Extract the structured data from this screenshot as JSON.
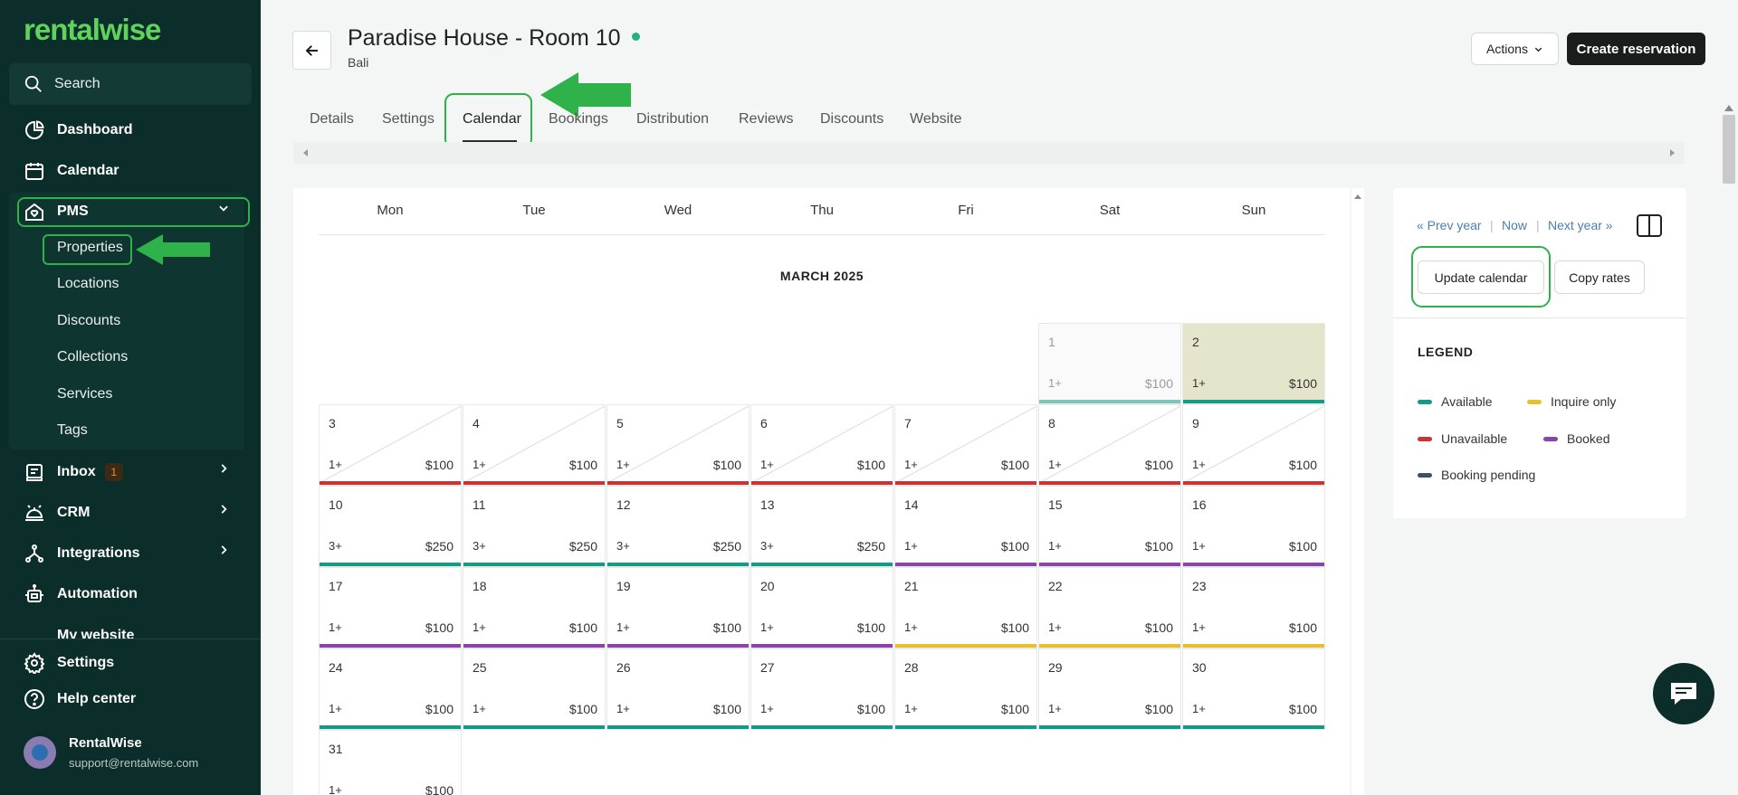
{
  "app": {
    "logo": "rentalwise"
  },
  "sidebar": {
    "search_label": "Search",
    "nav": {
      "dashboard": "Dashboard",
      "calendar": "Calendar",
      "pms": "PMS",
      "inbox": "Inbox",
      "inbox_badge": "1",
      "crm": "CRM",
      "integrations": "Integrations",
      "automation": "Automation",
      "my_website": "My website",
      "settings": "Settings",
      "help": "Help center"
    },
    "pms_items": [
      "Properties",
      "Locations",
      "Discounts",
      "Collections",
      "Services",
      "Tags"
    ],
    "user": {
      "name": "RentalWise",
      "email": "support@rentalwise.com"
    }
  },
  "header": {
    "title": "Paradise House - Room 10",
    "subtitle": "Bali",
    "actions_label": "Actions",
    "create_label": "Create reservation"
  },
  "tabs": [
    "Details",
    "Settings",
    "Calendar",
    "Bookings",
    "Distribution",
    "Reviews",
    "Discounts",
    "Website"
  ],
  "calendar": {
    "weekdays": [
      "Mon",
      "Tue",
      "Wed",
      "Thu",
      "Fri",
      "Sat",
      "Sun"
    ],
    "month": "MARCH 2025",
    "days": [
      {
        "d": "1",
        "min": "1+",
        "price": "$100",
        "status": "available",
        "past": true
      },
      {
        "d": "2",
        "min": "1+",
        "price": "$100",
        "status": "available",
        "today": true
      },
      {
        "d": "3",
        "min": "1+",
        "price": "$100",
        "status": "unavailable",
        "diag": true
      },
      {
        "d": "4",
        "min": "1+",
        "price": "$100",
        "status": "unavailable",
        "diag": true
      },
      {
        "d": "5",
        "min": "1+",
        "price": "$100",
        "status": "unavailable",
        "diag": true
      },
      {
        "d": "6",
        "min": "1+",
        "price": "$100",
        "status": "unavailable",
        "diag": true
      },
      {
        "d": "7",
        "min": "1+",
        "price": "$100",
        "status": "unavailable",
        "diag": true
      },
      {
        "d": "8",
        "min": "1+",
        "price": "$100",
        "status": "unavailable",
        "diag": true
      },
      {
        "d": "9",
        "min": "1+",
        "price": "$100",
        "status": "unavailable",
        "diag": true
      },
      {
        "d": "10",
        "min": "3+",
        "price": "$250",
        "status": "available"
      },
      {
        "d": "11",
        "min": "3+",
        "price": "$250",
        "status": "available"
      },
      {
        "d": "12",
        "min": "3+",
        "price": "$250",
        "status": "available"
      },
      {
        "d": "13",
        "min": "3+",
        "price": "$250",
        "status": "available"
      },
      {
        "d": "14",
        "min": "1+",
        "price": "$100",
        "status": "booked"
      },
      {
        "d": "15",
        "min": "1+",
        "price": "$100",
        "status": "booked"
      },
      {
        "d": "16",
        "min": "1+",
        "price": "$100",
        "status": "booked"
      },
      {
        "d": "17",
        "min": "1+",
        "price": "$100",
        "status": "booked"
      },
      {
        "d": "18",
        "min": "1+",
        "price": "$100",
        "status": "booked"
      },
      {
        "d": "19",
        "min": "1+",
        "price": "$100",
        "status": "booked"
      },
      {
        "d": "20",
        "min": "1+",
        "price": "$100",
        "status": "booked"
      },
      {
        "d": "21",
        "min": "1+",
        "price": "$100",
        "status": "inquire"
      },
      {
        "d": "22",
        "min": "1+",
        "price": "$100",
        "status": "inquire"
      },
      {
        "d": "23",
        "min": "1+",
        "price": "$100",
        "status": "inquire"
      },
      {
        "d": "24",
        "min": "1+",
        "price": "$100",
        "status": "available"
      },
      {
        "d": "25",
        "min": "1+",
        "price": "$100",
        "status": "available"
      },
      {
        "d": "26",
        "min": "1+",
        "price": "$100",
        "status": "available"
      },
      {
        "d": "27",
        "min": "1+",
        "price": "$100",
        "status": "available"
      },
      {
        "d": "28",
        "min": "1+",
        "price": "$100",
        "status": "available"
      },
      {
        "d": "29",
        "min": "1+",
        "price": "$100",
        "status": "available"
      },
      {
        "d": "30",
        "min": "1+",
        "price": "$100",
        "status": "available"
      },
      {
        "d": "31",
        "min": "1+",
        "price": "$100",
        "status": "available"
      }
    ]
  },
  "right_panel": {
    "prev_year": "« Prev year",
    "now": "Now",
    "next_year": "Next year »",
    "update_calendar": "Update calendar",
    "copy_rates": "Copy rates",
    "legend_title": "LEGEND",
    "legend": [
      {
        "label": "Available",
        "key": "available"
      },
      {
        "label": "Inquire only",
        "key": "inquire"
      },
      {
        "label": "Unavailable",
        "key": "unavailable"
      },
      {
        "label": "Booked",
        "key": "booked"
      },
      {
        "label": "Booking pending",
        "key": "pending"
      }
    ]
  },
  "colors": {
    "available": "#159a85",
    "unavailable": "#cc3333",
    "booked": "#8c44aa",
    "inquire": "#e6c030",
    "pending": "#3d5068",
    "accent": "#2fb24a",
    "sidebar_bg": "#0c2e2a"
  },
  "icons": {
    "search": "search-icon",
    "dashboard": "pie-chart-icon",
    "calendar": "calendar-icon",
    "pms": "house-heart-icon",
    "inbox": "inbox-icon",
    "crm": "concierge-bell-icon",
    "integrations": "network-icon",
    "automation": "robot-icon",
    "settings": "gear-icon",
    "help": "help-circle-icon",
    "back": "arrow-left-icon",
    "chat": "chat-icon"
  }
}
